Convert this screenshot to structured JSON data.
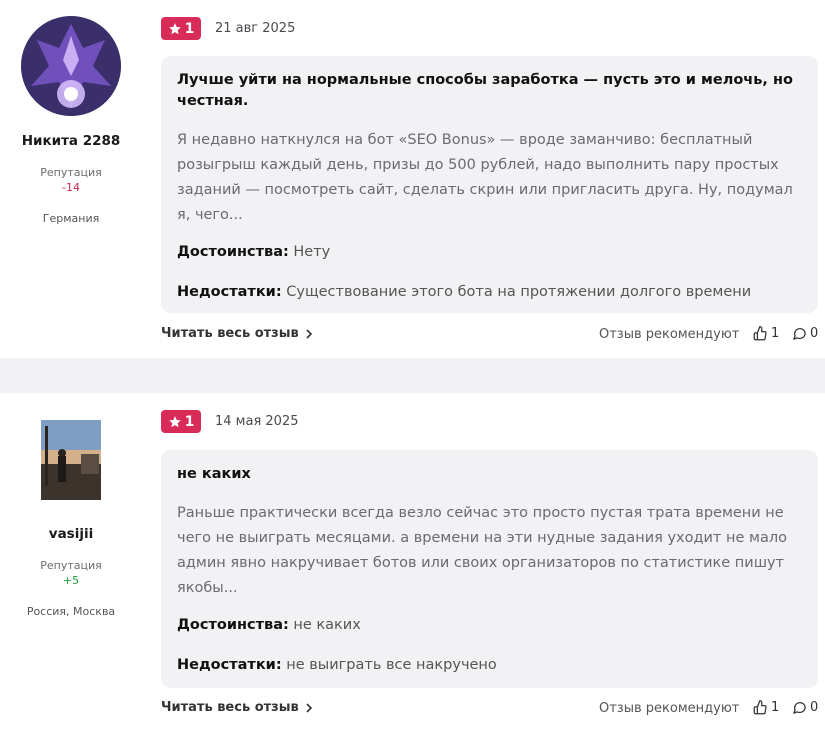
{
  "reviews": [
    {
      "author": {
        "name": "Никита 2288",
        "reputation_label": "Репутация",
        "reputation_value": "-14",
        "location": "Германия"
      },
      "rating": "1",
      "date": "21 авг 2025",
      "title": "Лучше уйти на нормальные способы заработка — пусть это и мелочь, но честная.",
      "body": "Я недавно наткнулся на бот «SEO Bonus» — вроде заманчиво: бесплатный розыгрыш каждый день, призы до 500 рублей, надо выполнить пару простых заданий — посмотреть сайт, сделать скрин или пригласить друга. Ну, подумал я, чего...",
      "pros_label": "Достоинства:",
      "pros": "Нету",
      "cons_label": "Недостатки:",
      "cons": "Существование этого бота на протяжении долгого времени",
      "read_full": "Читать весь отзыв",
      "recommend": "Отзыв рекомендуют",
      "likes": "1",
      "comments": "0"
    },
    {
      "author": {
        "name": "vasijii",
        "reputation_label": "Репутация",
        "reputation_value": "+5",
        "location": "Россия, Москва"
      },
      "rating": "1",
      "date": "14 мая 2025",
      "title": "не каких",
      "body": "Раньше практически всегда везло сейчас это просто пустая трата времени не чего не выиграть месяцами. а времени на эти нудные задания уходит не мало админ явно накручивает ботов или своих организаторов по статистике пишут якобы...",
      "pros_label": "Достоинства:",
      "pros": "не каких",
      "cons_label": "Недостатки:",
      "cons": "не выиграть все накручено",
      "read_full": "Читать весь отзыв",
      "recommend": "Отзыв рекомендуют",
      "likes": "1",
      "comments": "0"
    }
  ],
  "colors": {
    "badge": "#d92b58",
    "reputation_negative": "#c8284e",
    "reputation_positive": "#1e9a3a",
    "card_bg": "#f2f2f4"
  },
  "icons": [
    "star-icon",
    "chevron-right-icon",
    "thumbs-up-icon",
    "comment-icon"
  ]
}
